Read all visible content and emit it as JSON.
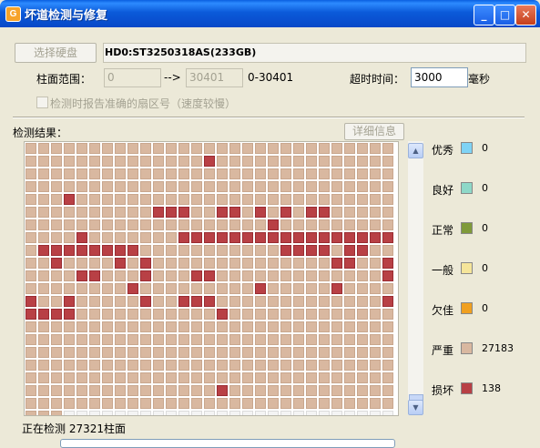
{
  "window": {
    "title": "坏道检测与修复",
    "app_icon_glyph": "G"
  },
  "controls": {
    "select_disk_button": "选择硬盘",
    "disk_name": "HD0:ST3250318AS(233GB)",
    "cylinder_label": "柱面范围：",
    "cylinder_from": "0",
    "arrow": "-->",
    "cylinder_to": "30401",
    "cylinder_range_text": "0-30401",
    "timeout_label": "超时时间：",
    "timeout_value": "3000",
    "timeout_unit": "毫秒",
    "report_sector_checkbox": "检测时报告准确的扇区号（速度较慢）"
  },
  "results": {
    "label": "检测结果：",
    "detail_button": "详细信息"
  },
  "legend": [
    {
      "name": "优秀",
      "count": "0",
      "color": "#7fd3f5"
    },
    {
      "name": "良好",
      "count": "0",
      "color": "#8ed8c8"
    },
    {
      "name": "正常",
      "count": "0",
      "color": "#7f9a3a"
    },
    {
      "name": "一般",
      "count": "0",
      "color": "#f5e59a"
    },
    {
      "name": "欠佳",
      "count": "0",
      "color": "#f0a020"
    },
    {
      "name": "严重",
      "count": "27183",
      "color": "#d9b8a0"
    },
    {
      "name": "损坏",
      "count": "138",
      "color": "#b84045"
    }
  ],
  "status": {
    "text": "正在检测 27321柱面"
  },
  "grid_map": {
    "columns": 29,
    "rows": [
      ".............................",
      "..............B..............",
      ".............................",
      "..............................B",
      "...B.........................",
      "..........BBB..BB.B.B.BB.....",
      "...................B.........",
      "....B.......BBBBBBBBBBBBBBBBB",
      ".BBBBBBBB...........BBBB.BB..B",
      "..B....B.B..............BB..B",
      "....BB...B...BB.............B",
      "........B.........B.....B....",
      "B..B.....B..BBB.............B",
      "BBBB...........B.............",
      ".............................",
      ".............................",
      ".............................",
      ".............................",
      ".............................",
      "...............B.............",
      ".............................",
      "...EEEEEEEEEEEEEEEEEEEEEEEEEE"
    ]
  }
}
